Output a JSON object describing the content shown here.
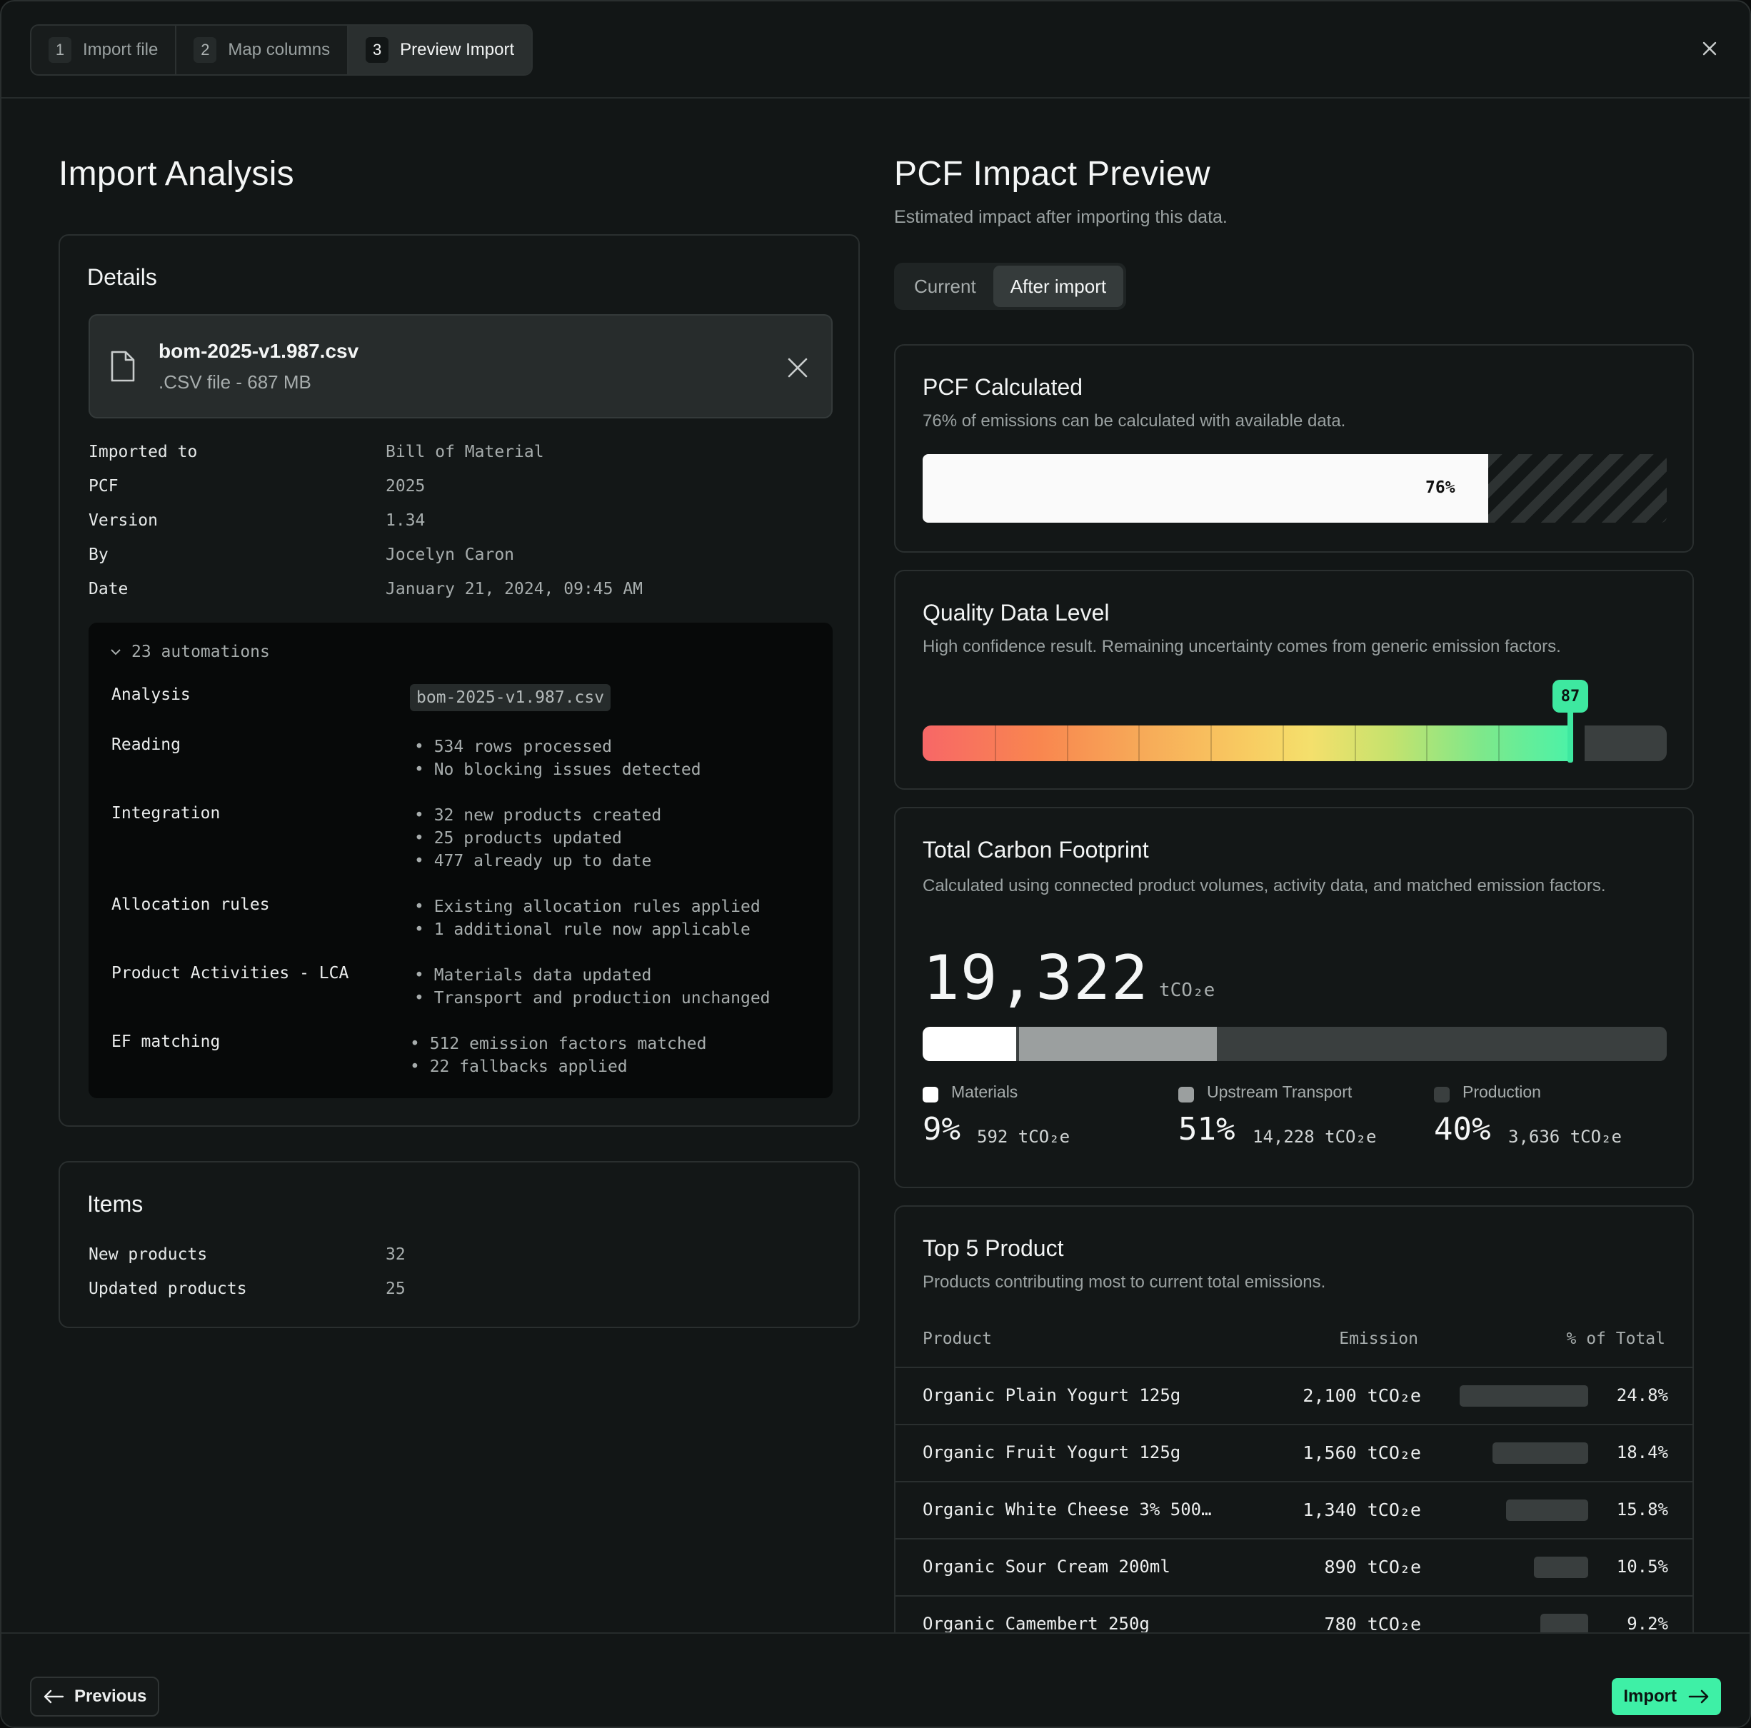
{
  "steps": [
    {
      "num": "1",
      "label": "Import file"
    },
    {
      "num": "2",
      "label": "Map columns"
    },
    {
      "num": "3",
      "label": "Preview Import"
    }
  ],
  "left": {
    "title": "Import Analysis",
    "details": {
      "title": "Details",
      "file": {
        "name": "bom-2025-v1.987.csv",
        "meta": ".CSV file - 687 MB"
      },
      "rows": [
        {
          "k": "Imported to",
          "v": "Bill of Material"
        },
        {
          "k": "PCF",
          "v": "2025"
        },
        {
          "k": "Version",
          "v": "1.34"
        },
        {
          "k": "By",
          "v": "Jocelyn Caron"
        },
        {
          "k": "Date",
          "v": "January 21, 2024, 09:45 AM"
        }
      ],
      "automations": {
        "toggle": "23 automations",
        "rows": [
          {
            "label": "Analysis",
            "chip": "bom-2025-v1.987.csv"
          },
          {
            "label": "Reading",
            "items": [
              "534 rows processed",
              "No blocking issues detected"
            ]
          },
          {
            "label": "Integration",
            "items": [
              "32 new products created",
              "25 products updated",
              "477 already up to date"
            ]
          },
          {
            "label": "Allocation rules",
            "items": [
              "Existing allocation rules applied",
              "1 additional rule now applicable"
            ]
          },
          {
            "label": "Product Activities - LCA",
            "items": [
              "Materials data updated",
              "Transport and production unchanged"
            ]
          },
          {
            "label": "EF matching",
            "items": [
              "512 emission factors matched",
              "22 fallbacks applied"
            ]
          }
        ]
      }
    },
    "items": {
      "title": "Items",
      "rows": [
        {
          "k": "New products",
          "v": "32"
        },
        {
          "k": "Updated products",
          "v": "25"
        }
      ]
    }
  },
  "right": {
    "title": "PCF Impact Preview",
    "subtitle": "Estimated impact after importing this data.",
    "toggle": {
      "current": "Current",
      "after": "After import"
    },
    "pcf": {
      "title": "PCF Calculated",
      "subtitle": "76% of emissions can be calculated with available data.",
      "percent": 76,
      "label": "76%"
    },
    "quality": {
      "title": "Quality Data Level",
      "subtitle": "High confidence result. Remaining uncertainty comes from generic emission factors.",
      "score": 87,
      "label": "87"
    },
    "footprint": {
      "title": "Total Carbon Footprint",
      "subtitle": "Calculated using connected product volumes, activity data, and matched emission factors.",
      "total": "19,322",
      "unit": "tCO₂e",
      "breakdown": [
        {
          "name": "Materials",
          "percent_label": "9%",
          "amount": "592 tCO₂e",
          "share": 13,
          "color": "#ffffff"
        },
        {
          "name": "Upstream Transport",
          "percent_label": "51%",
          "amount": "14,228 tCO₂e",
          "share": 27,
          "color": "#9b9f9f"
        },
        {
          "name": "Production",
          "percent_label": "40%",
          "amount": "3,636 tCO₂e",
          "share": 60,
          "color": "#3a3f3f"
        }
      ]
    },
    "top5": {
      "title": "Top 5 Product",
      "subtitle": "Products contributing most to current total emissions.",
      "headers": {
        "product": "Product",
        "emission": "Emission",
        "share": "% of Total"
      },
      "rows": [
        {
          "product": "Organic Plain Yogurt 125g",
          "emission": "2,100 tCO₂e",
          "pct": "24.8%",
          "value": 24.8
        },
        {
          "product": "Organic Fruit Yogurt 125g",
          "emission": "1,560 tCO₂e",
          "pct": "18.4%",
          "value": 18.4
        },
        {
          "product": "Organic White Cheese 3% 500…",
          "emission": "1,340 tCO₂e",
          "pct": "15.8%",
          "value": 15.8
        },
        {
          "product": "Organic Sour Cream 200ml",
          "emission": "890 tCO₂e",
          "pct": "10.5%",
          "value": 10.5
        },
        {
          "product": "Organic Camembert 250g",
          "emission": "780 tCO₂e",
          "pct": "9.2%",
          "value": 9.2
        }
      ]
    }
  },
  "footer": {
    "previous": "Previous",
    "import": "Import"
  },
  "colors": {
    "accent": "#3ef0a6",
    "background": "#121616",
    "card": "#131717"
  }
}
